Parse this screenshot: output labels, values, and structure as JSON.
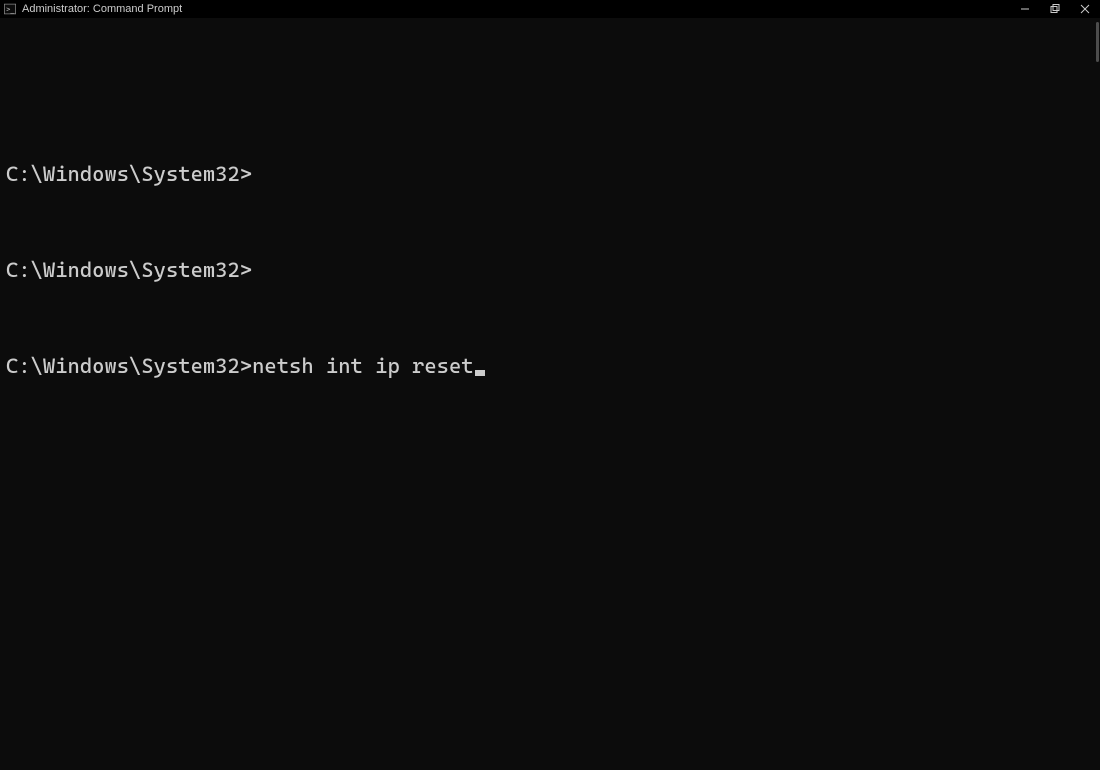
{
  "titlebar": {
    "title": "Administrator: Command Prompt"
  },
  "terminal": {
    "lines": [
      {
        "prompt": "C:\\Windows\\System32>",
        "input": "",
        "active": false
      },
      {
        "prompt": "C:\\Windows\\System32>",
        "input": "",
        "active": false
      },
      {
        "prompt": "C:\\Windows\\System32>",
        "input": "netsh int ip reset",
        "active": true
      }
    ]
  }
}
